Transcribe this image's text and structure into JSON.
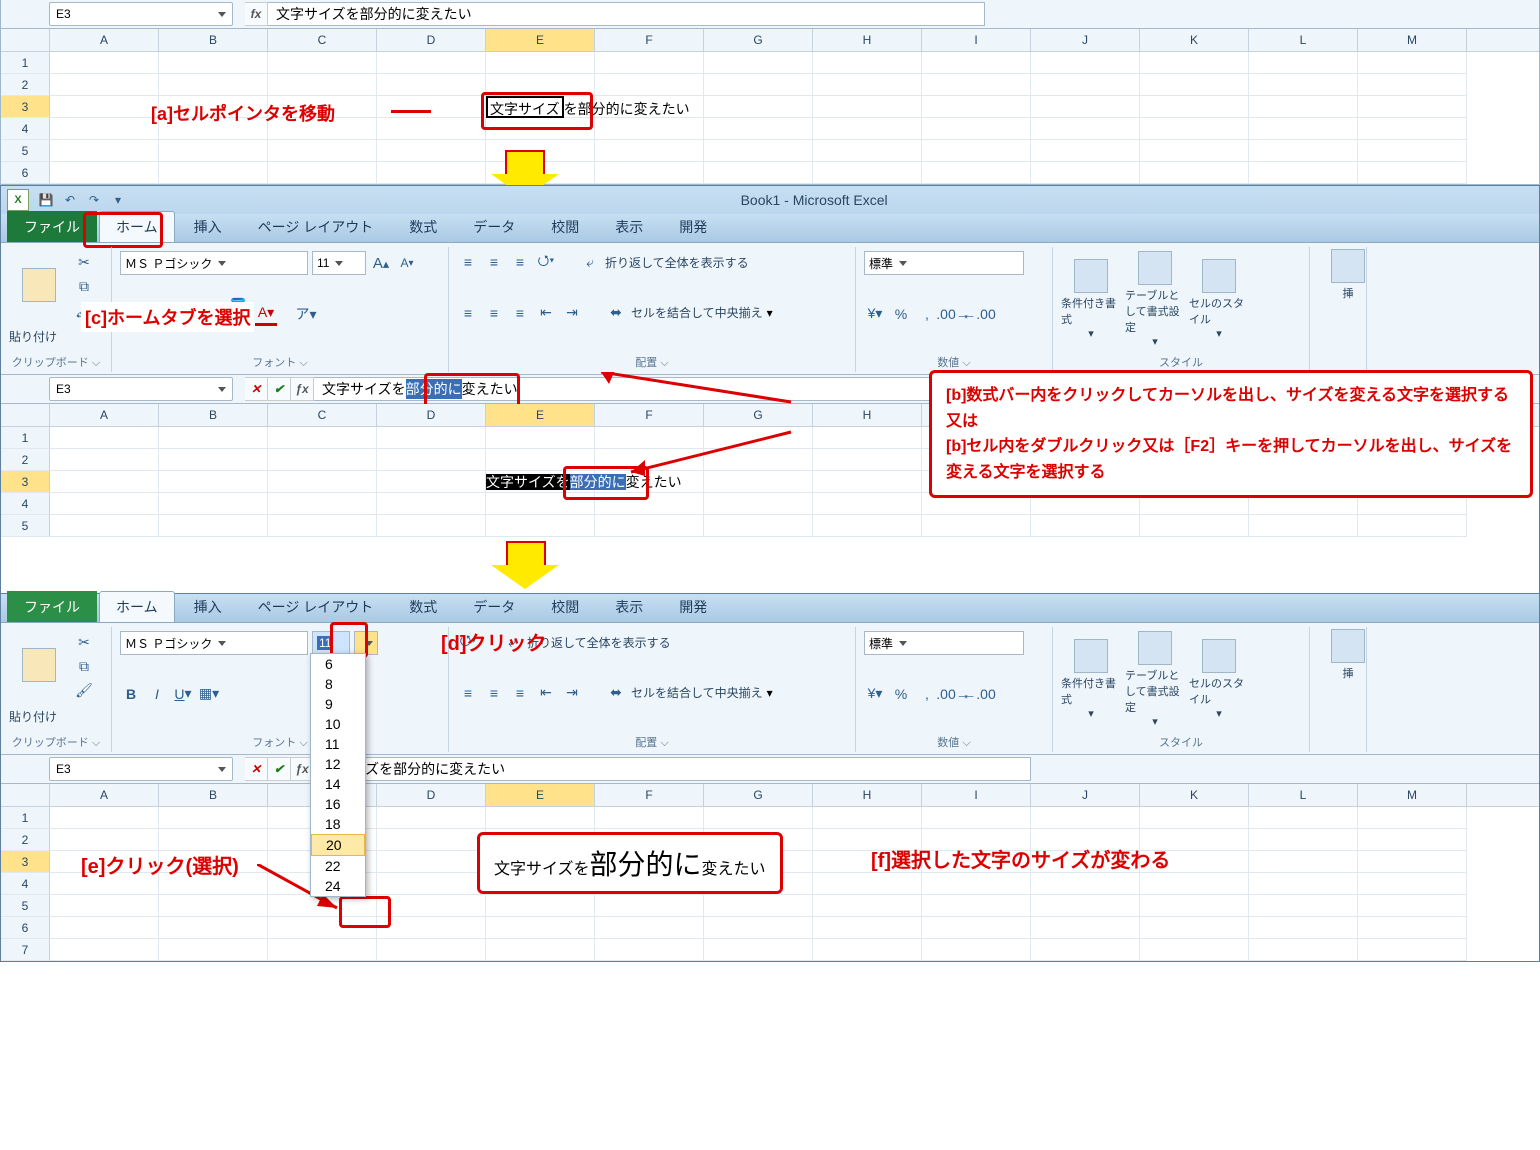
{
  "columns": [
    "A",
    "B",
    "C",
    "D",
    "E",
    "F",
    "G",
    "H",
    "I",
    "J",
    "K",
    "L",
    "M"
  ],
  "rows6": [
    "1",
    "2",
    "3",
    "4",
    "5",
    "6"
  ],
  "p1": {
    "namebox": "E3",
    "fx": "fx",
    "formula": "文字サイズを部分的に変えたい",
    "cell_e3": "文字サイズ",
    "cell_overflow": "を部分的に変えたい",
    "ann_a": "[a]セルポインタを移動"
  },
  "qat": {
    "title": "Book1 - Microsoft Excel"
  },
  "tabs": {
    "file": "ファイル",
    "home": "ホーム",
    "insert": "挿入",
    "layout": "ページ レイアウト",
    "formula": "数式",
    "data": "データ",
    "review": "校閲",
    "view": "表示",
    "dev": "開発"
  },
  "ribbon": {
    "paste": "貼り付け",
    "clipboard": "クリップボード",
    "font_name": "ＭＳ Ｐゴシック",
    "font_size": "11",
    "font": "フォント",
    "wrap": "折り返して全体を表示する",
    "merge": "セルを結合して中央揃え",
    "align": "配置",
    "numfmt": "標準",
    "number": "数値",
    "condfmt": "条件付き書式",
    "tblfmt": "テーブルとして書式設定",
    "cellstyle": "セルのスタイル",
    "styles": "スタイル",
    "insertbig": "挿"
  },
  "p2": {
    "ann_c": "[c]ホームタブを選択",
    "namebox": "E3",
    "formula_pre": "文字サイズを",
    "formula_sel": "部分的に",
    "formula_post": "変えたい",
    "cell_pre": "文字サイズを",
    "cell_sel": "部分的に",
    "cell_post": "変えたい",
    "callout_b1": "[b]数式バー内をクリックしてカーソルを出し、サイズを変える文字を選択する",
    "callout_or": "又は",
    "callout_b2": "[b]セル内をダブルクリック又は［F2］キーを押してカーソルを出し、サイズを変える文字を選択する"
  },
  "p3": {
    "ann_d": "[d]クリック",
    "ann_e": "[e]クリック(選択)",
    "ann_f": "[f]選択した文字のサイズが変わる",
    "namebox": "E3",
    "fsize_sel": "11",
    "formula": "サイズを部分的に変えたい",
    "sizes": [
      "6",
      "8",
      "9",
      "10",
      "11",
      "12",
      "14",
      "16",
      "18",
      "20",
      "22",
      "24"
    ],
    "sel_size": "20",
    "res_pre": "文字サイズを",
    "res_big": "部分的に",
    "res_post": "変えたい"
  }
}
